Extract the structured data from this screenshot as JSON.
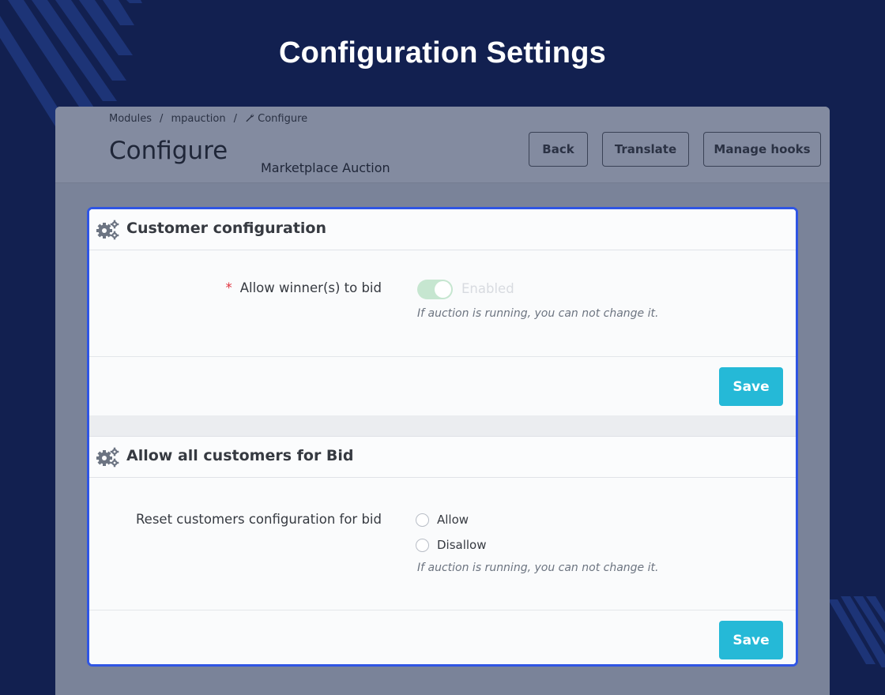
{
  "banner": {
    "title": "Configuration Settings"
  },
  "header": {
    "breadcrumb": [
      "Modules",
      "mpauction",
      "Configure"
    ],
    "title": "Configure",
    "module_name": "Marketplace Auction",
    "buttons": {
      "back": "Back",
      "translate": "Translate",
      "manage_hooks": "Manage hooks"
    }
  },
  "panel_customer": {
    "title": "Customer configuration",
    "required_mark": "*",
    "field_label": "Allow winner(s) to bid",
    "switch_state": "Enabled",
    "help": "If auction is running, you can not change it.",
    "save_label": "Save"
  },
  "panel_all_customers": {
    "title": "Allow all customers for Bid",
    "field_label": "Reset customers configuration for bid",
    "options": [
      "Allow",
      "Disallow"
    ],
    "help": "If auction is running, you can not change it.",
    "save_label": "Save"
  },
  "colors": {
    "background": "#122050",
    "focus_border": "#2f55e4",
    "save_button": "#25b9d7",
    "required": "#e0323e",
    "switch_on": "#c6e6d0"
  },
  "icons": [
    "cogs-icon",
    "wrench-icon"
  ]
}
